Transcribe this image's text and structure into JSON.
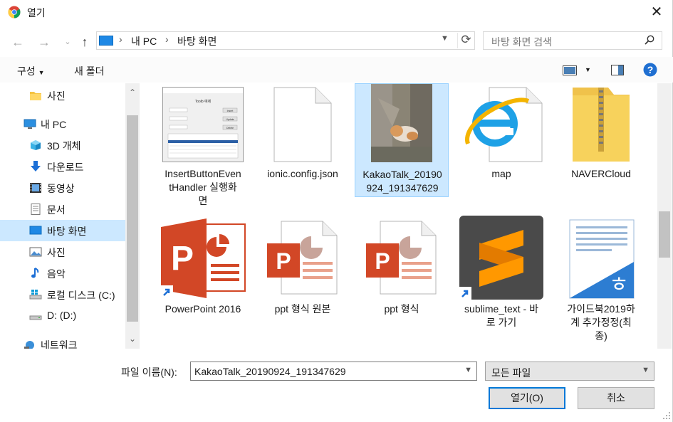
{
  "window": {
    "title": "열기"
  },
  "address": {
    "crumbs": [
      "내 PC",
      "바탕 화면"
    ]
  },
  "search": {
    "placeholder": "바탕 화면 검색"
  },
  "toolbar": {
    "organize": "구성",
    "new_folder": "새 폴더"
  },
  "sidebar": {
    "items": [
      {
        "label": "사진",
        "icon": "folder-icon"
      },
      {
        "label": "내 PC",
        "icon": "pc-icon"
      },
      {
        "label": "3D 개체",
        "icon": "cube-icon"
      },
      {
        "label": "다운로드",
        "icon": "download-icon"
      },
      {
        "label": "동영상",
        "icon": "video-icon"
      },
      {
        "label": "문서",
        "icon": "document-icon"
      },
      {
        "label": "바탕 화면",
        "icon": "desktop-icon"
      },
      {
        "label": "사진",
        "icon": "pictures-icon"
      },
      {
        "label": "음악",
        "icon": "music-icon"
      },
      {
        "label": "로컬 디스크 (C:)",
        "icon": "windows-drive-icon"
      },
      {
        "label": "D: (D:)",
        "icon": "drive-icon"
      },
      {
        "label": "네트워크",
        "icon": "network-icon"
      }
    ]
  },
  "files": [
    {
      "caption_lines": [
        "InsertButtonEven",
        "tHandler 실행화",
        "면"
      ],
      "kind": "screenshot"
    },
    {
      "caption_lines": [
        "ionic.config.json"
      ],
      "kind": "blank-file"
    },
    {
      "caption_lines": [
        "KakaoTalk_20190",
        "924_191347629"
      ],
      "kind": "photo"
    },
    {
      "caption_lines": [
        "map"
      ],
      "kind": "ie-file"
    },
    {
      "caption_lines": [
        "NAVERCloud"
      ],
      "kind": "zip-folder"
    },
    {
      "caption_lines": [
        "PowerPoint 2016"
      ],
      "kind": "powerpoint-shortcut"
    },
    {
      "caption_lines": [
        "ppt 형식 원본"
      ],
      "kind": "ppt-file"
    },
    {
      "caption_lines": [
        "ppt 형식"
      ],
      "kind": "ppt-file"
    },
    {
      "caption_lines": [
        "sublime_text - 바",
        "로 가기"
      ],
      "kind": "sublime-shortcut"
    },
    {
      "caption_lines": [
        "가이드북2019하",
        "계 추가정정(최",
        "종)"
      ],
      "kind": "hwp-file"
    }
  ],
  "bottom": {
    "filename_label": "파일 이름(N):",
    "filename_value": "KakaoTalk_20190924_191347629",
    "filetype_value": "모든 파일",
    "open_button": "열기(O)",
    "cancel_button": "취소"
  },
  "thumb_text": {
    "app_title": "Toolb 예제",
    "rows": [
      "Insert",
      "Update",
      "Delete"
    ]
  },
  "colors": {
    "accent": "#0078d7",
    "selection": "#cce8ff",
    "ppt": "#d24726",
    "sublime": "#ff9800"
  }
}
